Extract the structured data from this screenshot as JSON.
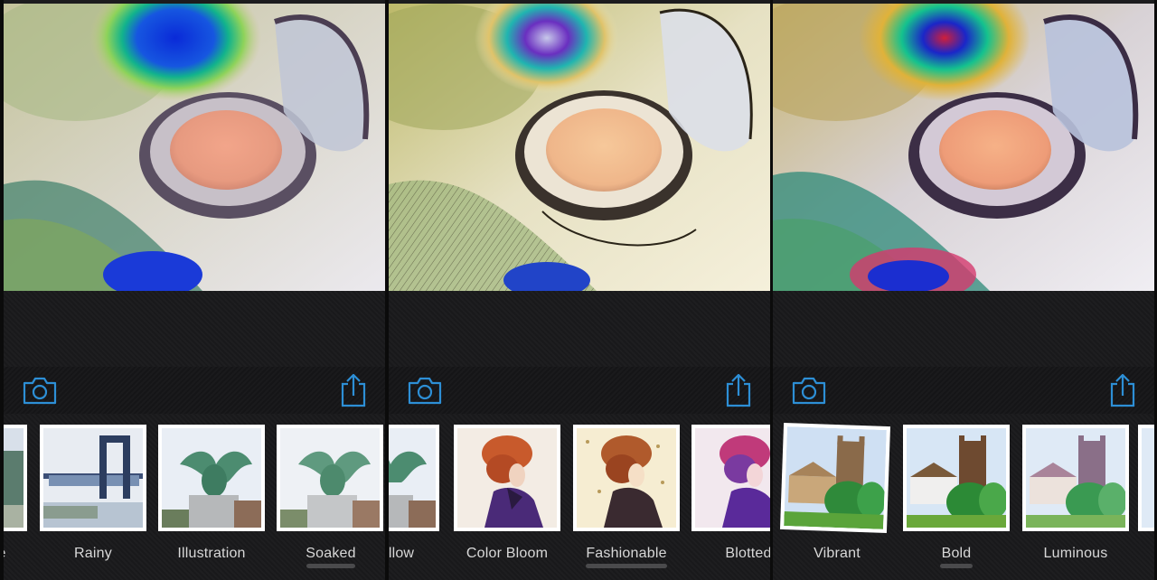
{
  "colors": {
    "accent": "#2d8fd6",
    "chrome_bg": "#1c1c1e",
    "label": "#d8d8d8"
  },
  "icons": {
    "camera": "camera-icon",
    "share": "share-icon"
  },
  "panels": [
    {
      "styles": [
        "e",
        "Rainy",
        "Illustration",
        "Soaked"
      ],
      "selected": "Soaked"
    },
    {
      "styles": [
        "llow",
        "Color Bloom",
        "Fashionable",
        "Blotted"
      ],
      "selected": "Fashionable"
    },
    {
      "styles": [
        "Vibrant",
        "Bold",
        "Luminous"
      ],
      "selected": "Bold"
    }
  ]
}
